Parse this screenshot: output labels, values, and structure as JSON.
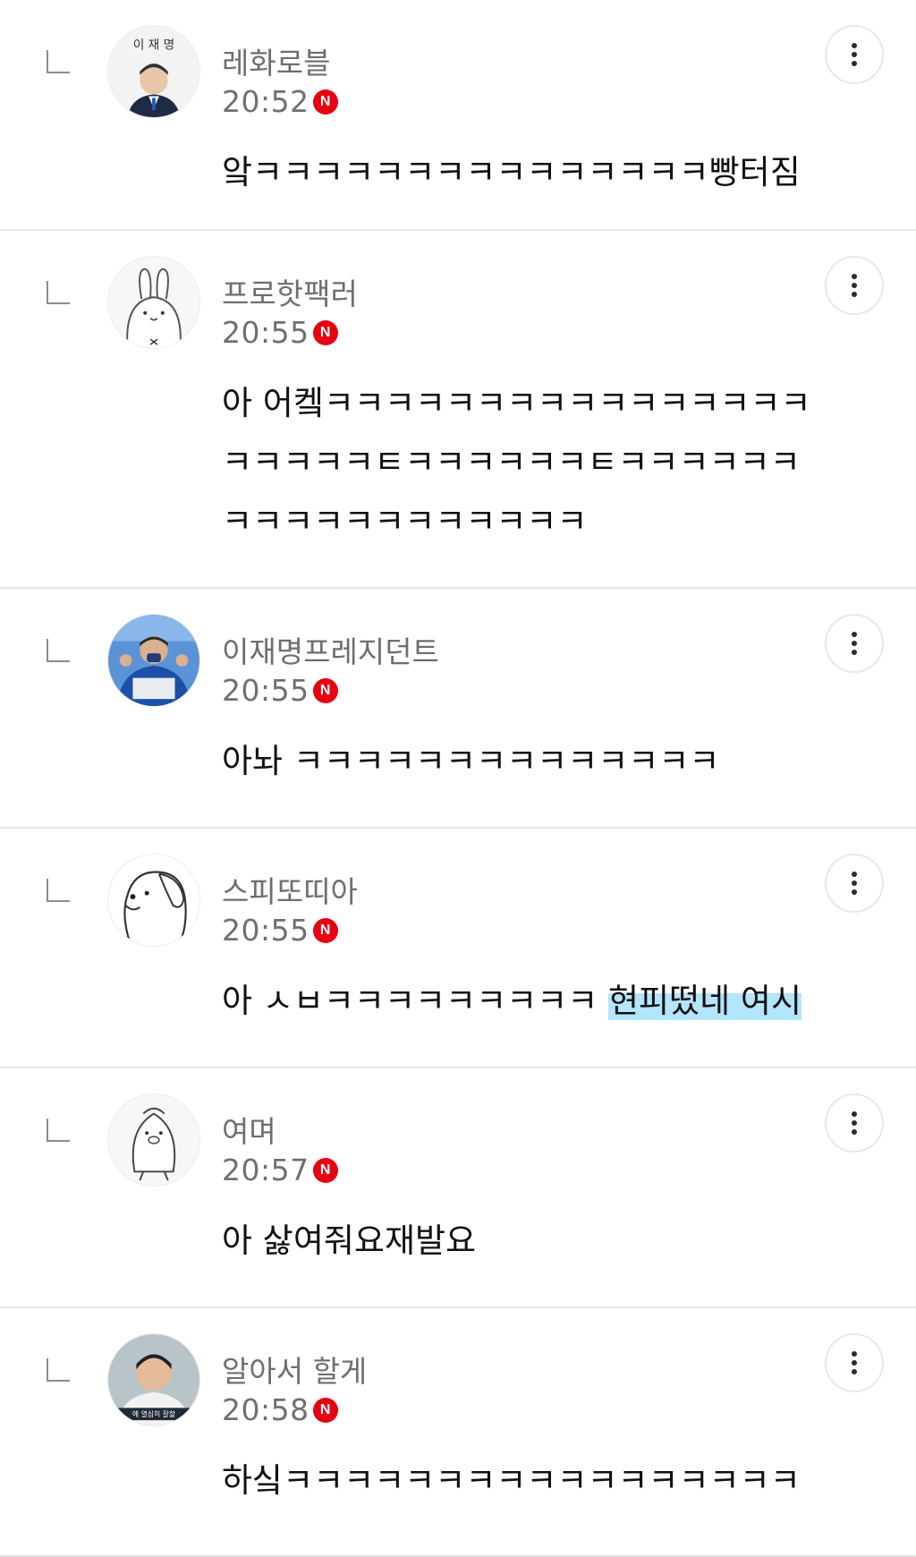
{
  "replies": [
    {
      "nickname": "레화로블",
      "time": "20:52",
      "badge": "N",
      "comment": "앜ㅋㅋㅋㅋㅋㅋㅋㅋㅋㅋㅋㅋㅋㅋㅋ빵터짐",
      "avatar": "politician-badge-avatar"
    },
    {
      "nickname": "프로핫팩러",
      "time": "20:55",
      "badge": "N",
      "comment": "아 어켘ㅋㅋㅋㅋㅋㅋㅋㅋㅋㅋㅋㅋㅋㅋㅋㅋㅋㅋㅋㅋㅋㅌㅋㅋㅋㅋㅋㅋㅌㅋㅋㅋㅋㅋㅋㅋㅋㅋㅋㅋㅋㅋㅋㅋㅋㅋㅋ",
      "avatar": "rabbit-doodle-avatar"
    },
    {
      "nickname": "이재명프레지던트",
      "time": "20:55",
      "badge": "N",
      "comment": "아놔 ㅋㅋㅋㅋㅋㅋㅋㅋㅋㅋㅋㅋㅋㅋ",
      "avatar": "speaker-photo-avatar"
    },
    {
      "nickname": "스피또띠아",
      "time": "20:55",
      "badge": "N",
      "comment_pre": "아 ㅅㅂㅋㅋㅋㅋㅋㅋㅋㅋㅋ ",
      "comment_highlight": "현피떴네 여시",
      "avatar": "dog-doodle-avatar"
    },
    {
      "nickname": "여며",
      "time": "20:57",
      "badge": "N",
      "comment": "아 삻여줘요재발요",
      "avatar": "penguin-doodle-avatar"
    },
    {
      "nickname": "알아서 할게",
      "time": "20:58",
      "badge": "N",
      "comment": "하싴ㅋㅋㅋㅋㅋㅋㅋㅋㅋㅋㅋㅋㅋㅋㅋㅋㅋ",
      "avatar": "man-photo-avatar",
      "avatar_caption": "에 열심히 잘할"
    }
  ],
  "colors": {
    "badge": "#e60012",
    "highlight": "#b3e5fc",
    "meta_text": "#707070",
    "divider": "#e6e6e6"
  }
}
